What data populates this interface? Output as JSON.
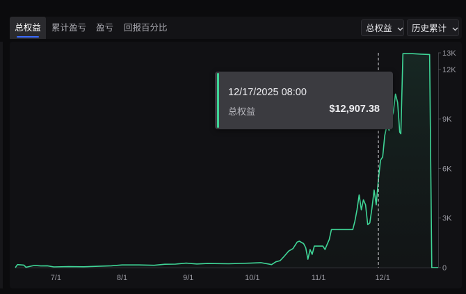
{
  "tabs": [
    {
      "label": "总权益",
      "active": true
    },
    {
      "label": "累计盈亏",
      "active": false
    },
    {
      "label": "盈亏",
      "active": false
    },
    {
      "label": "回报百分比",
      "active": false
    }
  ],
  "dropdowns": {
    "metric": "总权益",
    "range": "历史累计"
  },
  "tooltip": {
    "date": "12/17/2025 08:00",
    "label": "总权益",
    "value": "$12,907.38"
  },
  "colors": {
    "line": "#3fd597",
    "accent": "#3c6cff",
    "background": "#0b0b0d"
  },
  "chart_data": {
    "type": "area",
    "title": "",
    "xlabel": "",
    "ylabel": "",
    "x_ticks": [
      "7/1",
      "8/1",
      "9/1",
      "10/1",
      "11/1",
      "12/1"
    ],
    "y_ticks": [
      "0",
      "3K",
      "6K",
      "9K",
      "12K",
      "13K"
    ],
    "y_tick_values": [
      0,
      3000,
      6000,
      9000,
      12000,
      13000
    ],
    "ylim": [
      0,
      13000
    ],
    "xlim_days": [
      0,
      198
    ],
    "grid": false,
    "crosshair_day": 170,
    "series": [
      {
        "name": "总权益",
        "points": [
          [
            0,
            0
          ],
          [
            1,
            180
          ],
          [
            4,
            150
          ],
          [
            5,
            20
          ],
          [
            7,
            80
          ],
          [
            9,
            130
          ],
          [
            12,
            100
          ],
          [
            15,
            110
          ],
          [
            18,
            40
          ],
          [
            25,
            60
          ],
          [
            32,
            50
          ],
          [
            40,
            90
          ],
          [
            45,
            110
          ],
          [
            50,
            160
          ],
          [
            58,
            160
          ],
          [
            65,
            140
          ],
          [
            70,
            200
          ],
          [
            75,
            210
          ],
          [
            80,
            270
          ],
          [
            85,
            220
          ],
          [
            90,
            250
          ],
          [
            100,
            230
          ],
          [
            110,
            270
          ],
          [
            115,
            300
          ],
          [
            120,
            180
          ],
          [
            122,
            350
          ],
          [
            124,
            420
          ],
          [
            126,
            700
          ],
          [
            128,
            1000
          ],
          [
            130,
            1150
          ],
          [
            132,
            1550
          ],
          [
            133,
            1600
          ],
          [
            135,
            1450
          ],
          [
            136,
            1200
          ],
          [
            137,
            500
          ],
          [
            138,
            1100
          ],
          [
            139,
            800
          ],
          [
            140,
            1300
          ],
          [
            144,
            1300
          ],
          [
            145,
            1100
          ],
          [
            146,
            1400
          ],
          [
            147,
            1700
          ],
          [
            148,
            2300
          ],
          [
            153,
            2300
          ],
          [
            158,
            2300
          ],
          [
            159,
            2800
          ],
          [
            160,
            3500
          ],
          [
            161,
            4400
          ],
          [
            162,
            3500
          ],
          [
            163,
            4100
          ],
          [
            164,
            3800
          ],
          [
            165,
            2600
          ],
          [
            166,
            2700
          ],
          [
            167,
            3600
          ],
          [
            168,
            4700
          ],
          [
            169,
            3800
          ],
          [
            170,
            5300
          ],
          [
            171,
            6500
          ],
          [
            172,
            6700
          ],
          [
            173,
            8000
          ],
          [
            174,
            8600
          ],
          [
            175,
            8300
          ],
          [
            176,
            9000
          ],
          [
            177,
            9400
          ],
          [
            178,
            10500
          ],
          [
            179,
            10000
          ],
          [
            180,
            8200
          ],
          [
            180.5,
            8100
          ],
          [
            181,
            10500
          ],
          [
            181.5,
            12950
          ],
          [
            186,
            12950
          ],
          [
            190,
            12920
          ],
          [
            194,
            12900
          ],
          [
            195,
            0
          ],
          [
            198,
            0
          ]
        ]
      }
    ]
  }
}
